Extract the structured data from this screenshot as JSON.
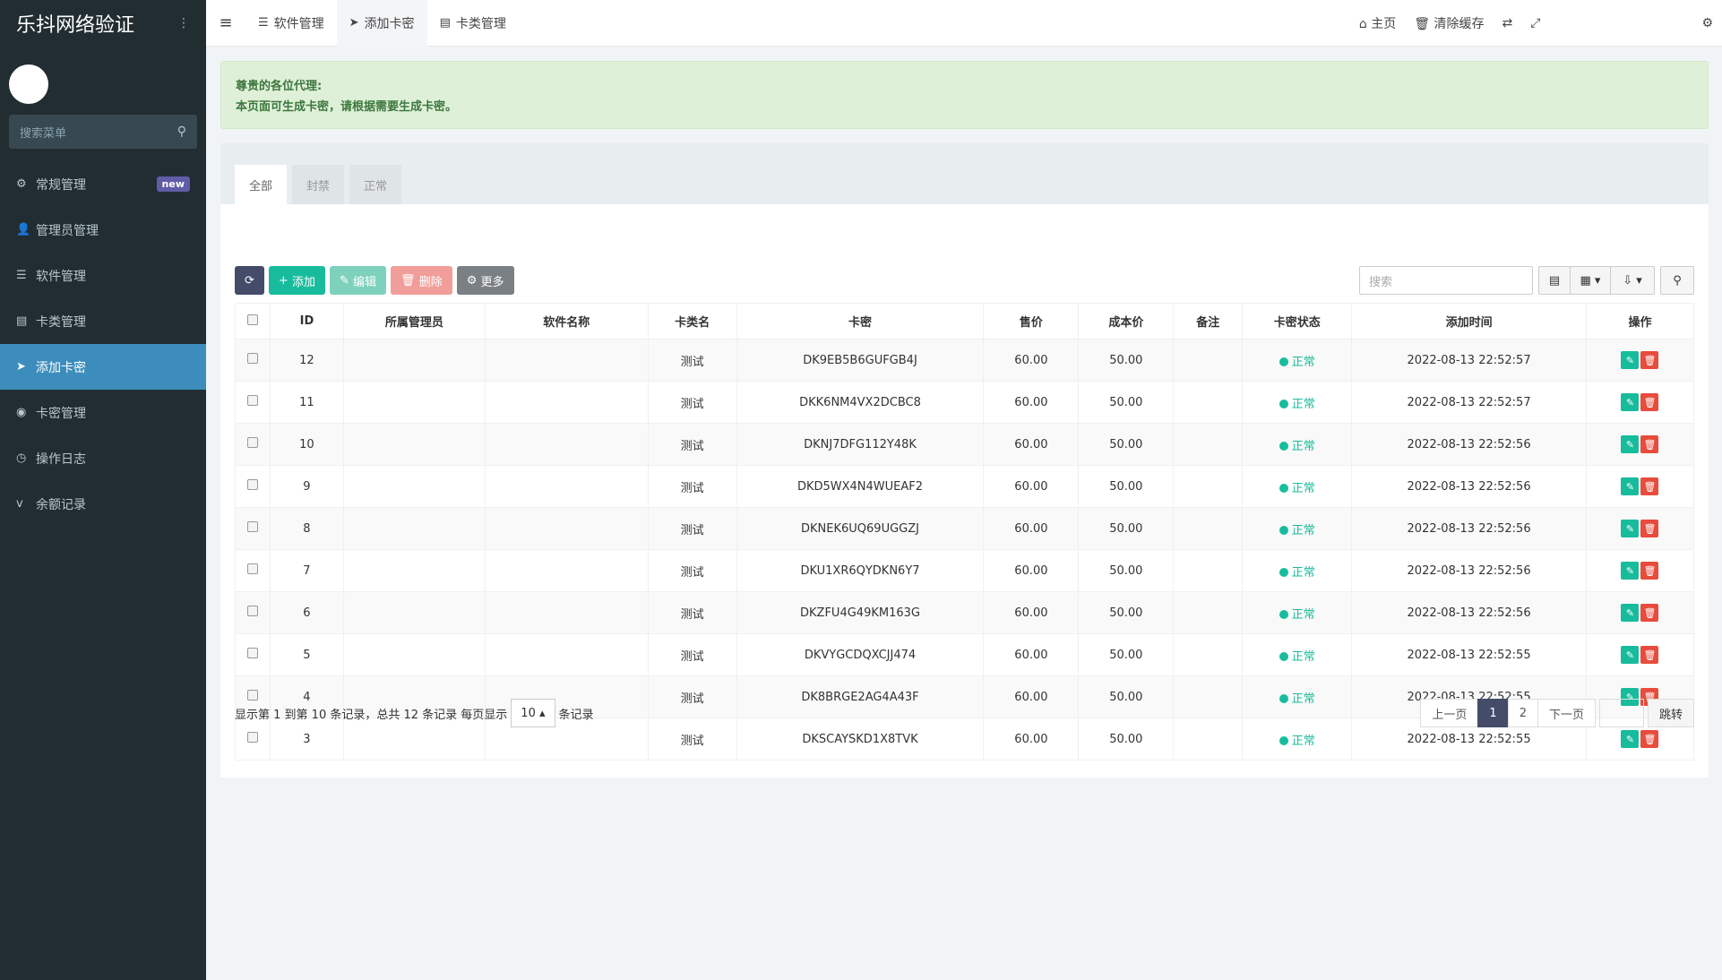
{
  "sidebar": {
    "logo": "乐抖网络验证",
    "search_placeholder": "搜索菜单",
    "items": [
      {
        "label": "常规管理",
        "badge": "new"
      },
      {
        "label": "管理员管理"
      },
      {
        "label": "软件管理"
      },
      {
        "label": "卡类管理"
      },
      {
        "label": "添加卡密"
      },
      {
        "label": "卡密管理"
      },
      {
        "label": "操作日志"
      },
      {
        "label": "余额记录"
      }
    ]
  },
  "header": {
    "tabs": [
      "软件管理",
      "添加卡密",
      "卡类管理"
    ],
    "home": "主页",
    "clear_cache": "清除缓存"
  },
  "alert": {
    "line1": "尊贵的各位代理:",
    "line2": "本页面可生成卡密，请根据需要生成卡密。"
  },
  "panel_tabs": [
    "全部",
    "封禁",
    "正常"
  ],
  "toolbar": {
    "add": "添加",
    "edit": "编辑",
    "delete": "删除",
    "more": "更多",
    "search_placeholder": "搜索"
  },
  "table": {
    "columns": [
      "ID",
      "所属管理员",
      "软件名称",
      "卡类名",
      "卡密",
      "售价",
      "成本价",
      "备注",
      "卡密状态",
      "添加时间",
      "操作"
    ],
    "rows": [
      {
        "id": "12",
        "admin": "",
        "software": "",
        "type": "测试",
        "card": "DK9EB5B6GUFGB4J",
        "price": "60.00",
        "cost": "50.00",
        "note": "",
        "status": "正常",
        "time": "2022-08-13 22:52:57"
      },
      {
        "id": "11",
        "admin": "",
        "software": "",
        "type": "测试",
        "card": "DKK6NM4VX2DCBC8",
        "price": "60.00",
        "cost": "50.00",
        "note": "",
        "status": "正常",
        "time": "2022-08-13 22:52:57"
      },
      {
        "id": "10",
        "admin": "",
        "software": "",
        "type": "测试",
        "card": "DKNJ7DFG112Y48K",
        "price": "60.00",
        "cost": "50.00",
        "note": "",
        "status": "正常",
        "time": "2022-08-13 22:52:56"
      },
      {
        "id": "9",
        "admin": "",
        "software": "",
        "type": "测试",
        "card": "DKD5WX4N4WUEAF2",
        "price": "60.00",
        "cost": "50.00",
        "note": "",
        "status": "正常",
        "time": "2022-08-13 22:52:56"
      },
      {
        "id": "8",
        "admin": "",
        "software": "",
        "type": "测试",
        "card": "DKNEK6UQ69UGGZJ",
        "price": "60.00",
        "cost": "50.00",
        "note": "",
        "status": "正常",
        "time": "2022-08-13 22:52:56"
      },
      {
        "id": "7",
        "admin": "",
        "software": "",
        "type": "测试",
        "card": "DKU1XR6QYDKN6Y7",
        "price": "60.00",
        "cost": "50.00",
        "note": "",
        "status": "正常",
        "time": "2022-08-13 22:52:56"
      },
      {
        "id": "6",
        "admin": "",
        "software": "",
        "type": "测试",
        "card": "DKZFU4G49KM163G",
        "price": "60.00",
        "cost": "50.00",
        "note": "",
        "status": "正常",
        "time": "2022-08-13 22:52:56"
      },
      {
        "id": "5",
        "admin": "",
        "software": "",
        "type": "测试",
        "card": "DKVYGCDQXCJJ474",
        "price": "60.00",
        "cost": "50.00",
        "note": "",
        "status": "正常",
        "time": "2022-08-13 22:52:55"
      },
      {
        "id": "4",
        "admin": "",
        "software": "",
        "type": "测试",
        "card": "DK8BRGE2AG4A43F",
        "price": "60.00",
        "cost": "50.00",
        "note": "",
        "status": "正常",
        "time": "2022-08-13 22:52:55"
      },
      {
        "id": "3",
        "admin": "",
        "software": "",
        "type": "测试",
        "card": "DKSCAYSKD1X8TVK",
        "price": "60.00",
        "cost": "50.00",
        "note": "",
        "status": "正常",
        "time": "2022-08-13 22:52:55"
      }
    ]
  },
  "pager": {
    "summary": "显示第 1 到第 10 条记录，总共 12 条记录 每页显示",
    "page_size": "10",
    "suffix": "条记录",
    "prev": "上一页",
    "pages": [
      "1",
      "2"
    ],
    "next": "下一页",
    "jump": "跳转"
  }
}
